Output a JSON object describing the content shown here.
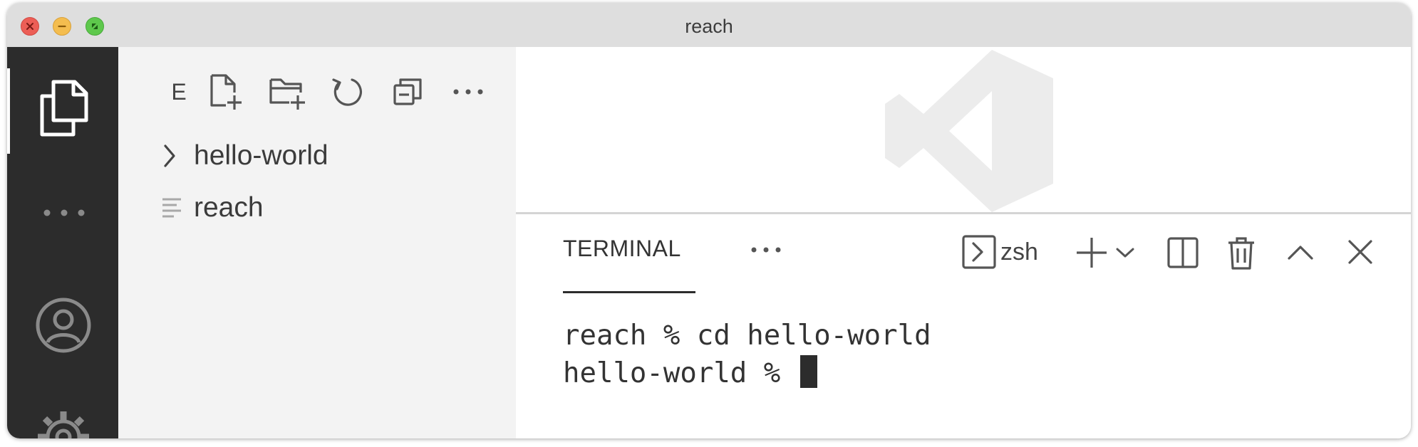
{
  "window": {
    "title": "reach"
  },
  "colors": {
    "activity_bar": "#2c2c2c",
    "sidebar": "#f3f3f3",
    "close": "#ec5e56",
    "minimize": "#f4bd4f",
    "zoom": "#5ec84c"
  },
  "activity_bar": {
    "items": [
      {
        "icon": "files-icon",
        "active": true
      },
      {
        "icon": "more-icon"
      },
      {
        "icon": "account-icon"
      },
      {
        "icon": "settings-gear-icon"
      }
    ]
  },
  "explorer": {
    "toolbar_letter": "E",
    "toolbar_icons": [
      "new-file-icon",
      "new-folder-icon",
      "refresh-icon",
      "collapse-all-icon",
      "more-icon"
    ],
    "tree": [
      {
        "label": "hello-world",
        "type": "folder",
        "expanded": false
      },
      {
        "label": "reach",
        "type": "file"
      }
    ]
  },
  "panel": {
    "tab": "TERMINAL",
    "shell": "zsh",
    "actions": [
      "terminal-icon",
      "add-icon",
      "chevron-down-icon",
      "split-icon",
      "trash-icon",
      "chevron-up-icon",
      "close-icon"
    ]
  },
  "terminal": {
    "lines": [
      "reach % cd hello-world",
      "hello-world % "
    ]
  }
}
